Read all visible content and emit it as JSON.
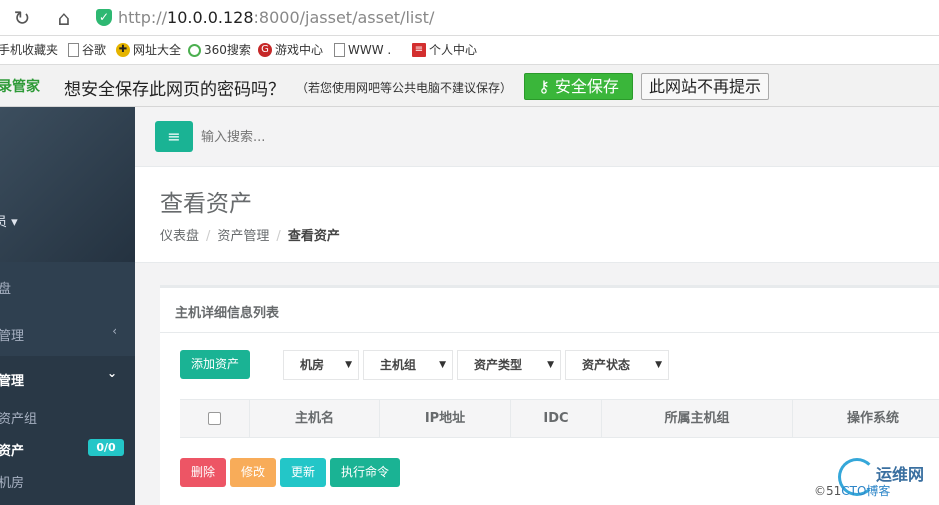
{
  "browser": {
    "url_scheme": "http://",
    "url_host": "10.0.0.128",
    "url_rest": ":8000/jasset/asset/list/",
    "bookmarks": [
      {
        "label": "手机收藏夹",
        "icon": "folder-icon"
      },
      {
        "label": "谷歌",
        "icon": "page-icon"
      },
      {
        "label": "网址大全",
        "icon": "site-directory-icon"
      },
      {
        "label": "360搜索",
        "icon": "360-search-icon"
      },
      {
        "label": "游戏中心",
        "icon": "game-center-icon"
      },
      {
        "label": "WWW .",
        "icon": "page-icon"
      },
      {
        "label": "个人中心",
        "icon": "personal-center-icon"
      }
    ]
  },
  "password_bar": {
    "brand": "录管家",
    "question": "想安全保存此网页的密码吗？",
    "note": "（若您使用网吧等公共电脑不建议保存）",
    "save_label": "安全保存",
    "never_label": "此网站不再提示"
  },
  "sidebar": {
    "profile_name": "员 ▾",
    "items": [
      {
        "label": "盘",
        "chevron": ""
      },
      {
        "label": "管理",
        "chevron": "‹"
      },
      {
        "label": "管理",
        "chevron": "⌄"
      },
      {
        "label": "资产组",
        "chevron": ""
      },
      {
        "label": "资产",
        "chevron": "",
        "badge": "0/0"
      },
      {
        "label": "机房",
        "chevron": ""
      }
    ]
  },
  "topnav": {
    "search_placeholder": "输入搜索..."
  },
  "page": {
    "title": "查看资产",
    "breadcrumb": [
      "仪表盘",
      "资产管理",
      "查看资产"
    ]
  },
  "panel": {
    "title": "主机详细信息列表",
    "add_label": "添加资产",
    "filters": [
      "机房",
      "主机组",
      "资产类型",
      "资产状态"
    ],
    "columns": [
      "主机名",
      "IP地址",
      "IDC",
      "所属主机组",
      "操作系统"
    ],
    "actions": {
      "delete": "删除",
      "edit": "修改",
      "update": "更新",
      "exec": "执行命令"
    }
  },
  "watermark": {
    "brand": "运维网",
    "sub_a": "©51",
    "sub_b": "CTO博客"
  },
  "colors": {
    "primary": "#1ab394",
    "danger": "#ed5565",
    "warning": "#f8ac59",
    "info": "#23c6c8",
    "sidebar": "#2f4050"
  }
}
